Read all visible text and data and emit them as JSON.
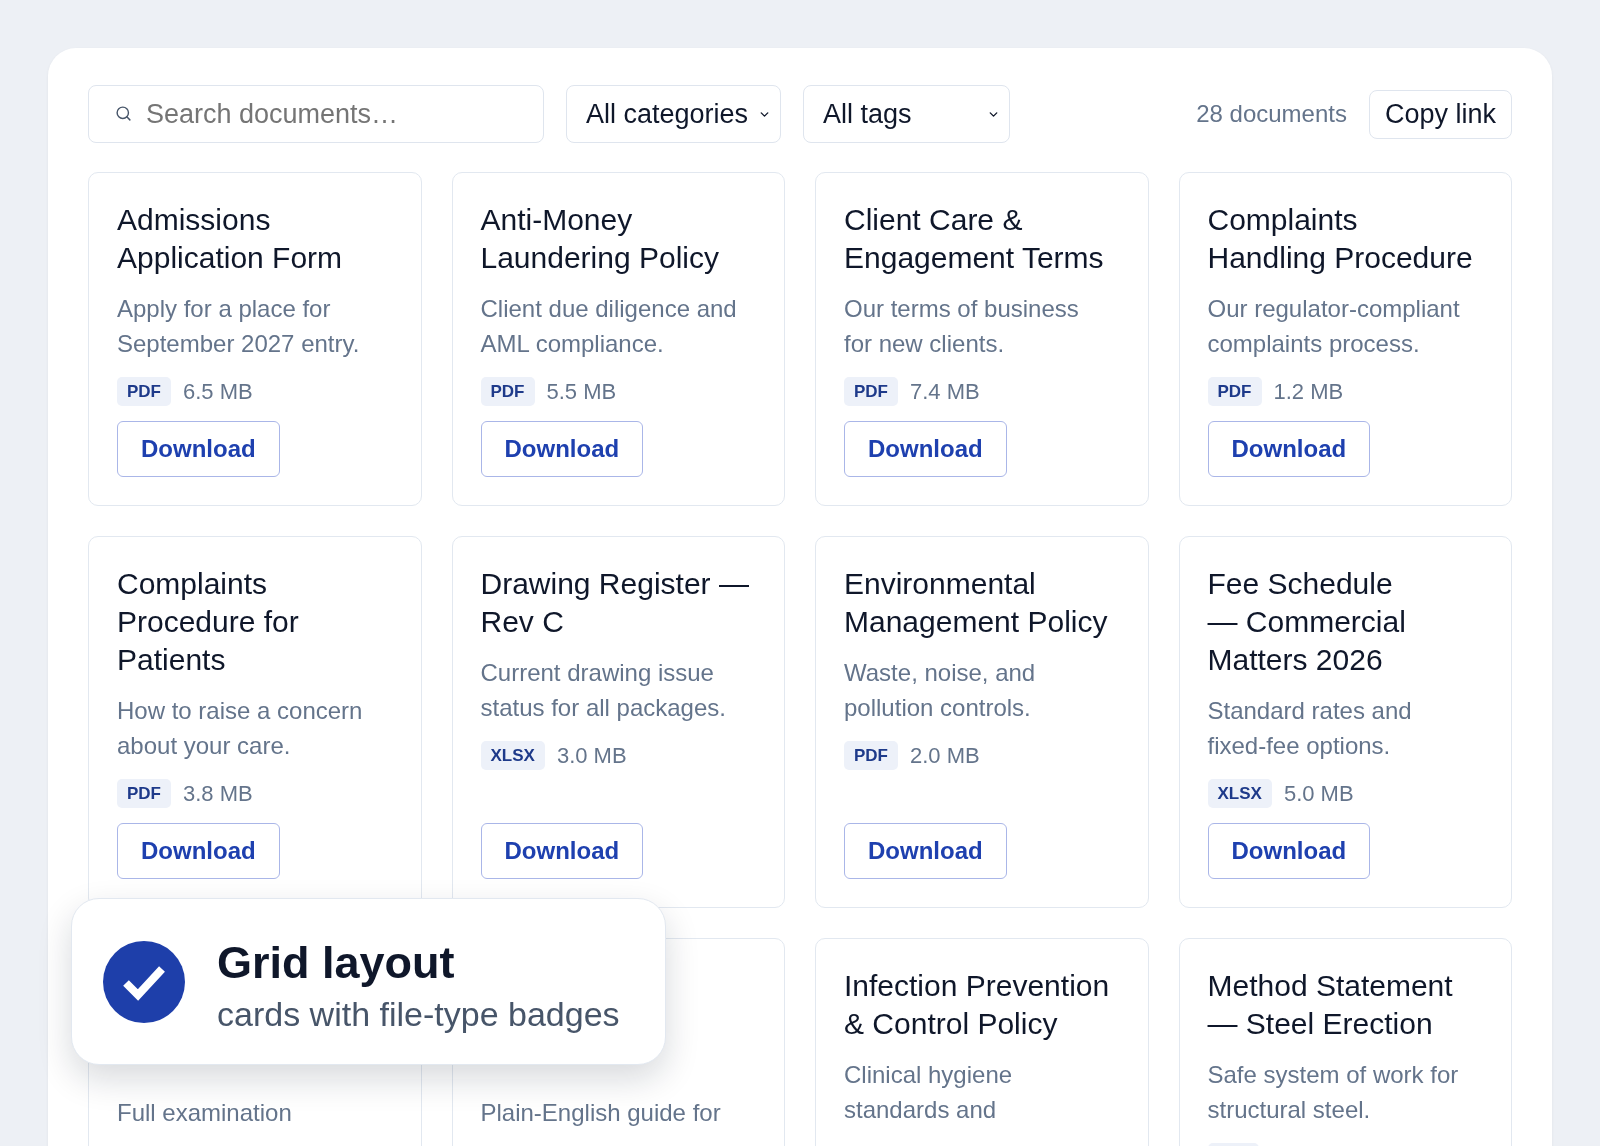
{
  "toolbar": {
    "search": {
      "placeholder": "Search documents…"
    },
    "category_filter": {
      "value": "All categories"
    },
    "tag_filter": {
      "value": "All tags"
    },
    "count": "28 documents",
    "copy_link": "Copy link"
  },
  "cards": [
    {
      "title": "Admissions Application Form",
      "description": "Apply for a place for September 2027 entry.",
      "file_type": "PDF",
      "size": "6.5 MB",
      "button": "Download"
    },
    {
      "title": "Anti-Money Laundering Policy",
      "description": "Client due diligence and AML compliance.",
      "file_type": "PDF",
      "size": "5.5 MB",
      "button": "Download"
    },
    {
      "title": "Client Care & Engagement Terms",
      "description": "Our terms of business for new clients.",
      "file_type": "PDF",
      "size": "7.4 MB",
      "button": "Download"
    },
    {
      "title": "Complaints Handling Procedure",
      "description": "Our regulator-compliant complaints process.",
      "file_type": "PDF",
      "size": "1.2 MB",
      "button": "Download"
    },
    {
      "title": "Complaints Procedure for Patients",
      "description": "How to raise a concern about your care.",
      "file_type": "PDF",
      "size": "3.8 MB",
      "button": "Download"
    },
    {
      "title": "Drawing Register — Rev C",
      "description": "Current drawing issue status for all packages.",
      "file_type": "XLSX",
      "size": "3.0 MB",
      "button": "Download"
    },
    {
      "title": "Environmental Management Policy",
      "description": "Waste, noise, and pollution controls.",
      "file_type": "PDF",
      "size": "2.0 MB",
      "button": "Download"
    },
    {
      "title": "Fee Schedule — Commercial Matters 2026",
      "description": "Standard rates and fixed-fee options.",
      "file_type": "XLSX",
      "size": "5.0 MB",
      "button": "Download"
    },
    {
      "description": "Full examination"
    },
    {
      "description": "Plain-English guide for"
    },
    {
      "title": "Infection Prevention & Control Policy",
      "description": "Clinical hygiene standards and"
    },
    {
      "title": "Method Statement — Steel Erection",
      "description": "Safe system of work for structural steel.",
      "badge": true
    }
  ],
  "toast": {
    "title": "Grid layout",
    "subtitle": "cards with file-type badges"
  }
}
